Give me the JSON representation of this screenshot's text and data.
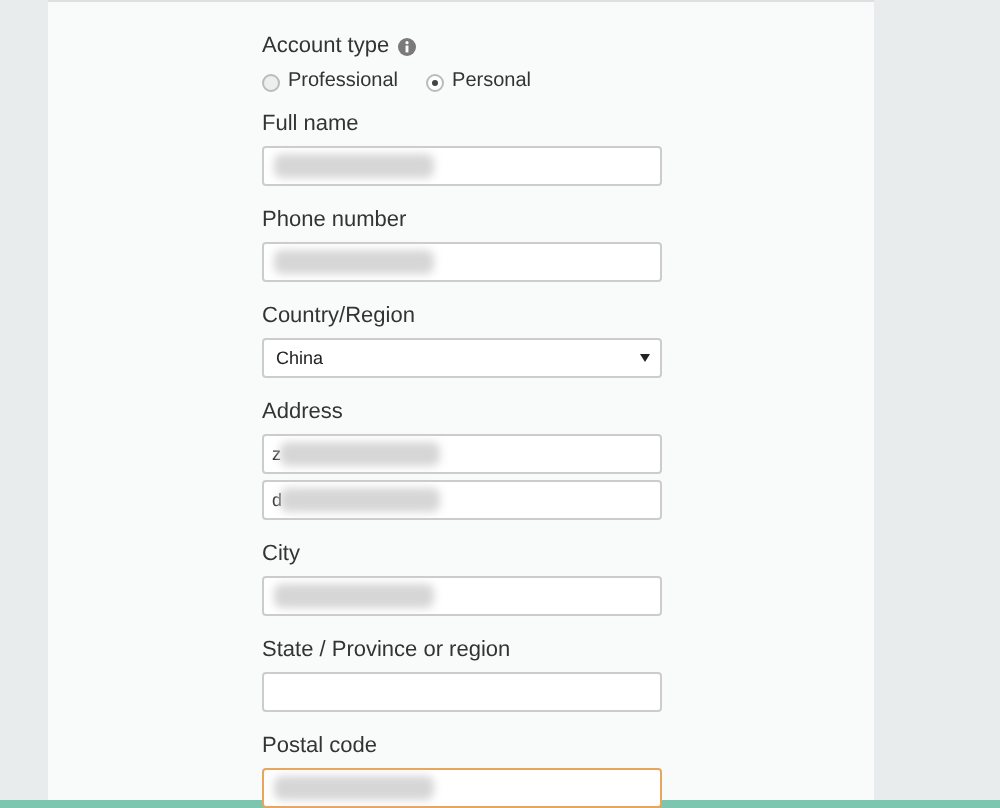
{
  "account_type": {
    "label": "Account type",
    "options": [
      {
        "label": "Professional",
        "selected": false
      },
      {
        "label": "Personal",
        "selected": true
      }
    ]
  },
  "fields": [
    {
      "kind": "text",
      "label": "Full name",
      "blurred": true
    },
    {
      "kind": "text",
      "label": "Phone number",
      "blurred": true
    },
    {
      "kind": "select",
      "label": "Country/Region",
      "value": "China"
    },
    {
      "kind": "text",
      "label": "Address",
      "value": "z",
      "blurred": true
    },
    {
      "kind": "text",
      "value": "d",
      "blurred": true
    },
    {
      "kind": "text",
      "label": "City",
      "blurred": true
    },
    {
      "kind": "text",
      "label": "State / Province or region"
    },
    {
      "kind": "text",
      "label": "Postal code",
      "blurred": true,
      "focused": true
    }
  ]
}
